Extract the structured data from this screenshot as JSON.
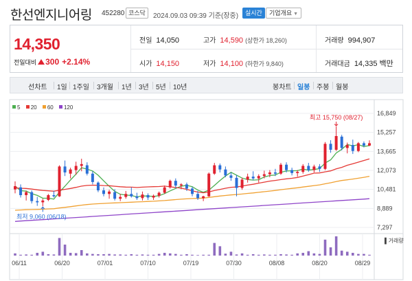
{
  "header": {
    "name": "한선엔지니어링",
    "code": "452280",
    "market": "코스닥",
    "datetime": "2024.09.03 09:39 기준(장중)",
    "realtime_label": "실시간",
    "overview_label": "기업개요"
  },
  "summary": {
    "price": "14,350",
    "change_label": "전일대비",
    "change": "300",
    "change_pct": "+2.14%",
    "prev_close_label": "전일",
    "prev_close": "14,050",
    "open_label": "시가",
    "open": "14,150",
    "high_label": "고가",
    "high": "14,590",
    "upper_limit": "(상한가 18,260)",
    "low_label": "저가",
    "low": "14,100",
    "lower_limit": "(하한가 9,840)",
    "volume_label": "거래량",
    "volume": "994,907",
    "amount_label": "거래대금",
    "amount": "14,335 백만",
    "up_color": "#e0212f"
  },
  "tabs": {
    "line_chart": "선차트",
    "periods": [
      "1일",
      "1주일",
      "3개월",
      "1년",
      "3년",
      "5년",
      "10년"
    ],
    "candle_chart": "봉차트",
    "candle_periods": [
      "일봉",
      "주봉",
      "월봉"
    ],
    "active": "일봉"
  },
  "chart_data": {
    "type": "candlestick",
    "legend": [
      {
        "name": "5",
        "color": "#4caf50"
      },
      {
        "name": "20",
        "color": "#e53935"
      },
      {
        "name": "60",
        "color": "#f0a030"
      },
      {
        "name": "120",
        "color": "#8e44c9"
      }
    ],
    "y_ticks": [
      "16,849",
      "15,257",
      "13,665",
      "12,073",
      "10,481",
      "8,889",
      "7,297"
    ],
    "ylim": [
      7297,
      16849
    ],
    "x_ticks": [
      "06/11",
      "06/20",
      "07/01",
      "07/10",
      "07/19",
      "07/30",
      "08/08",
      "08/20",
      "08/29"
    ],
    "annotation_high": "최고 15,750 (08/27)",
    "annotation_low": "최저 9,060 (06/18)",
    "volume_label": "거래량",
    "candles": [
      {
        "o": 10480,
        "h": 11150,
        "l": 10150,
        "c": 10750
      },
      {
        "o": 10650,
        "h": 10900,
        "l": 9800,
        "c": 10000
      },
      {
        "o": 10000,
        "h": 10380,
        "l": 9550,
        "c": 10250
      },
      {
        "o": 10250,
        "h": 10400,
        "l": 9300,
        "c": 9500
      },
      {
        "o": 9500,
        "h": 9850,
        "l": 9100,
        "c": 9400
      },
      {
        "o": 9400,
        "h": 9700,
        "l": 9060,
        "c": 9550
      },
      {
        "o": 9600,
        "h": 10100,
        "l": 9500,
        "c": 10000
      },
      {
        "o": 10000,
        "h": 10350,
        "l": 9800,
        "c": 9900
      },
      {
        "o": 9900,
        "h": 12500,
        "l": 9850,
        "c": 12400
      },
      {
        "o": 12400,
        "h": 12900,
        "l": 11600,
        "c": 11900
      },
      {
        "o": 11800,
        "h": 12300,
        "l": 11400,
        "c": 12150
      },
      {
        "o": 12100,
        "h": 12800,
        "l": 11700,
        "c": 12450
      },
      {
        "o": 12450,
        "h": 13050,
        "l": 12000,
        "c": 12600
      },
      {
        "o": 12500,
        "h": 12750,
        "l": 11650,
        "c": 11800
      },
      {
        "o": 11800,
        "h": 12000,
        "l": 10900,
        "c": 11100
      },
      {
        "o": 11050,
        "h": 11150,
        "l": 10250,
        "c": 10400
      },
      {
        "o": 10400,
        "h": 10650,
        "l": 9900,
        "c": 10100
      },
      {
        "o": 10100,
        "h": 10450,
        "l": 9700,
        "c": 10300
      },
      {
        "o": 10250,
        "h": 10500,
        "l": 9550,
        "c": 9700
      },
      {
        "o": 9700,
        "h": 10100,
        "l": 9500,
        "c": 9850
      },
      {
        "o": 9850,
        "h": 10350,
        "l": 9700,
        "c": 10100
      },
      {
        "o": 10100,
        "h": 10650,
        "l": 9800,
        "c": 9900
      },
      {
        "o": 9900,
        "h": 10200,
        "l": 9600,
        "c": 9750
      },
      {
        "o": 9750,
        "h": 10300,
        "l": 9550,
        "c": 10050
      },
      {
        "o": 10000,
        "h": 10150,
        "l": 9600,
        "c": 9800
      },
      {
        "o": 9800,
        "h": 10050,
        "l": 9600,
        "c": 9950
      },
      {
        "o": 9950,
        "h": 10300,
        "l": 9800,
        "c": 10200
      },
      {
        "o": 10200,
        "h": 10800,
        "l": 10100,
        "c": 10650
      },
      {
        "o": 10650,
        "h": 11300,
        "l": 10550,
        "c": 11200
      },
      {
        "o": 11200,
        "h": 11400,
        "l": 10600,
        "c": 10800
      },
      {
        "o": 10800,
        "h": 11000,
        "l": 10500,
        "c": 10900
      },
      {
        "o": 10900,
        "h": 11050,
        "l": 10350,
        "c": 10550
      },
      {
        "o": 10550,
        "h": 10700,
        "l": 9900,
        "c": 10100
      },
      {
        "o": 10100,
        "h": 10350,
        "l": 9600,
        "c": 9750
      },
      {
        "o": 9750,
        "h": 9950,
        "l": 9500,
        "c": 9900
      },
      {
        "o": 9900,
        "h": 11900,
        "l": 9850,
        "c": 11800
      },
      {
        "o": 11800,
        "h": 12700,
        "l": 11700,
        "c": 12500
      },
      {
        "o": 12500,
        "h": 12650,
        "l": 11900,
        "c": 12150
      },
      {
        "o": 12150,
        "h": 12400,
        "l": 11500,
        "c": 11650
      },
      {
        "o": 11650,
        "h": 11900,
        "l": 11200,
        "c": 11450
      },
      {
        "o": 11450,
        "h": 11700,
        "l": 9900,
        "c": 10600
      },
      {
        "o": 10600,
        "h": 11450,
        "l": 10450,
        "c": 11300
      },
      {
        "o": 11300,
        "h": 11800,
        "l": 11050,
        "c": 11550
      },
      {
        "o": 11550,
        "h": 12000,
        "l": 11250,
        "c": 11400
      },
      {
        "o": 11400,
        "h": 11750,
        "l": 11050,
        "c": 11600
      },
      {
        "o": 11600,
        "h": 12050,
        "l": 11400,
        "c": 11750
      },
      {
        "o": 11750,
        "h": 12100,
        "l": 11500,
        "c": 11900
      },
      {
        "o": 11900,
        "h": 12200,
        "l": 11600,
        "c": 11800
      },
      {
        "o": 11800,
        "h": 12700,
        "l": 11700,
        "c": 12550
      },
      {
        "o": 12550,
        "h": 12750,
        "l": 11900,
        "c": 12100
      },
      {
        "o": 12100,
        "h": 12300,
        "l": 11650,
        "c": 11850
      },
      {
        "o": 11850,
        "h": 12100,
        "l": 11550,
        "c": 11950
      },
      {
        "o": 11950,
        "h": 12600,
        "l": 11800,
        "c": 12450
      },
      {
        "o": 12450,
        "h": 12700,
        "l": 11950,
        "c": 12100
      },
      {
        "o": 12100,
        "h": 12550,
        "l": 11900,
        "c": 12400
      },
      {
        "o": 12400,
        "h": 12600,
        "l": 11950,
        "c": 12200
      },
      {
        "o": 12200,
        "h": 14450,
        "l": 12100,
        "c": 14300
      },
      {
        "o": 14300,
        "h": 14600,
        "l": 13550,
        "c": 13800
      },
      {
        "o": 13800,
        "h": 15750,
        "l": 13700,
        "c": 14950
      },
      {
        "o": 14900,
        "h": 15050,
        "l": 13750,
        "c": 13950
      },
      {
        "o": 13950,
        "h": 14400,
        "l": 13500,
        "c": 14200
      },
      {
        "o": 14200,
        "h": 14650,
        "l": 13450,
        "c": 13700
      },
      {
        "o": 13700,
        "h": 14450,
        "l": 13600,
        "c": 14350
      },
      {
        "o": 14350,
        "h": 14500,
        "l": 14000,
        "c": 14150
      },
      {
        "o": 14150,
        "h": 14590,
        "l": 14100,
        "c": 14350
      }
    ],
    "volumes": [
      8,
      3,
      4,
      3,
      10,
      14,
      5,
      4,
      64,
      40,
      10,
      9,
      20,
      8,
      6,
      5,
      5,
      6,
      4,
      4,
      3,
      5,
      3,
      4,
      3,
      3,
      6,
      10,
      8,
      6,
      3,
      5,
      3,
      2,
      3,
      3,
      46,
      34,
      7,
      14,
      4,
      8,
      3,
      5,
      3,
      4,
      3,
      3,
      5,
      4,
      3,
      8,
      10,
      16,
      8,
      6,
      58,
      30,
      70,
      18,
      14,
      10,
      6,
      6,
      3
    ]
  }
}
